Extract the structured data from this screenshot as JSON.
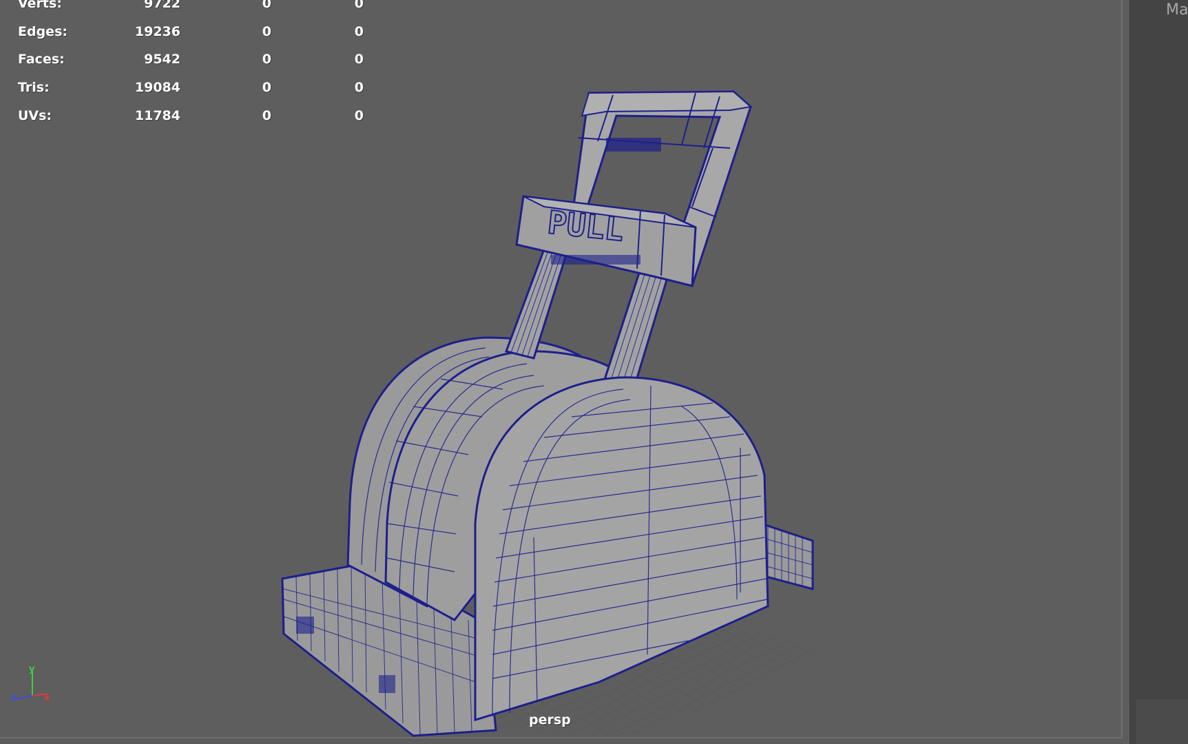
{
  "hud": {
    "rows": [
      {
        "label": "Verts:",
        "v1": "9722",
        "v2": "0",
        "v3": "0"
      },
      {
        "label": "Edges:",
        "v1": "19236",
        "v2": "0",
        "v3": "0"
      },
      {
        "label": "Faces:",
        "v1": "9542",
        "v2": "0",
        "v3": "0"
      },
      {
        "label": "Tris:",
        "v1": "19084",
        "v2": "0",
        "v3": "0"
      },
      {
        "label": "UVs:",
        "v1": "11784",
        "v2": "0",
        "v3": "0"
      }
    ]
  },
  "viewport": {
    "camera_label": "persp",
    "model_text": "PULL",
    "colors": {
      "background": "#5e5e5e",
      "wireframe": "#1c1f8c",
      "surface": "#9a9a9a",
      "grid": "#4f4f4f"
    }
  },
  "axis": {
    "y": "y",
    "z": "z",
    "x": "x"
  },
  "right_panel": {
    "label": "Ma"
  }
}
